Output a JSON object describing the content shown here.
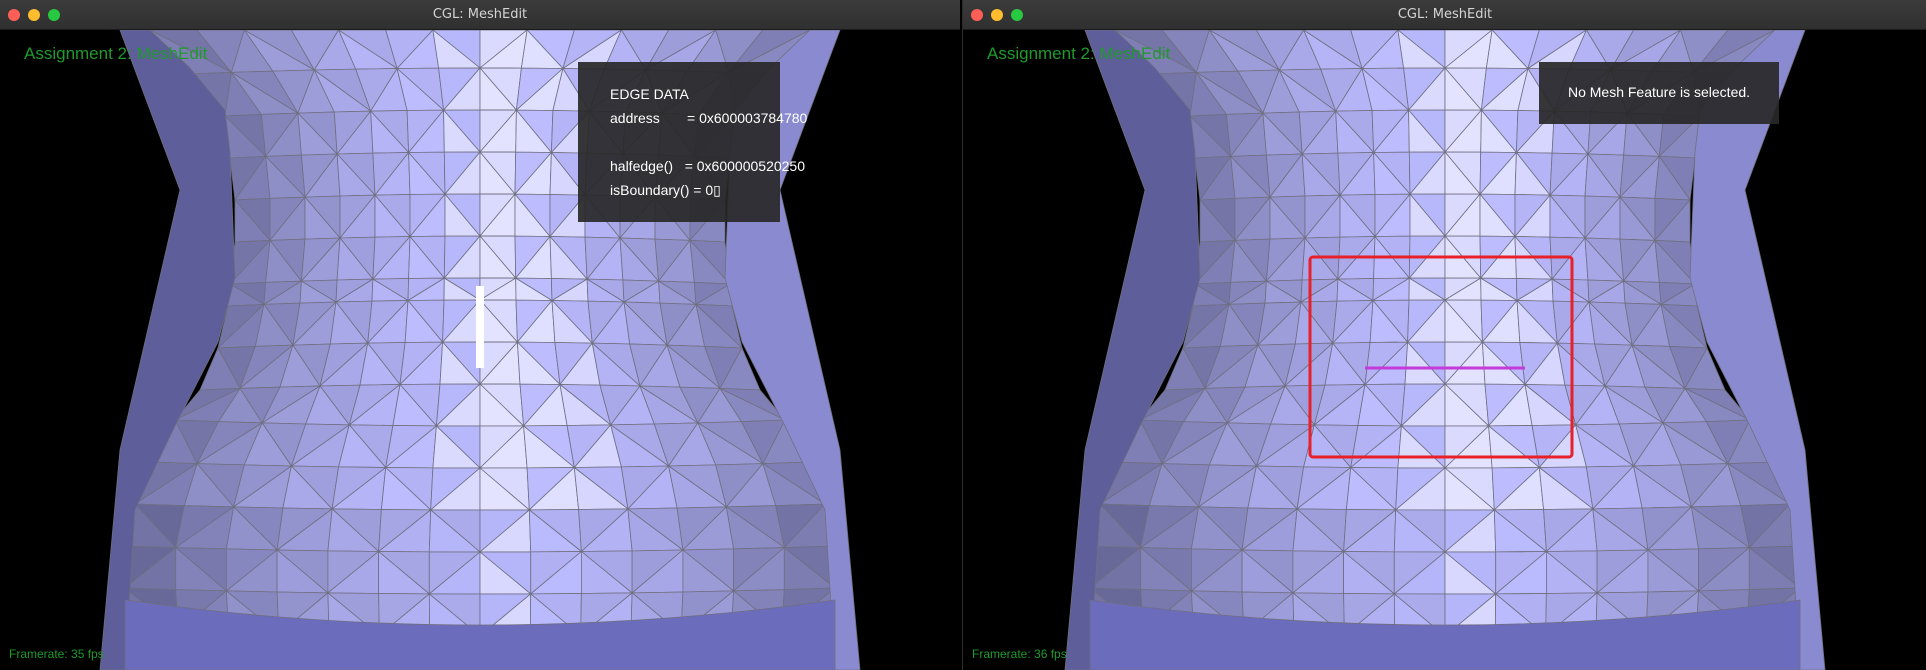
{
  "windows": [
    {
      "title": "CGL: MeshEdit",
      "heading": "Assignment 2: MeshEdit",
      "framerate": "Framerate: 35 fps",
      "panel": {
        "title": "EDGE DATA",
        "address": "address       = 0x600003784780",
        "halfedge": "halfedge()   = 0x600000520250",
        "isBoundary": "isBoundary() = 0▯"
      }
    },
    {
      "title": "CGL: MeshEdit",
      "heading": "Assignment 2: MeshEdit",
      "framerate": "Framerate: 36 fps",
      "panel": {
        "message": "No Mesh Feature is selected."
      }
    }
  ],
  "colors": {
    "mesh_fill": "#c6c6fa",
    "mesh_line": "#6f6f80",
    "heading": "#1f9a2c",
    "highlight_box": "#e8202a",
    "flipped_edge": "#c43bd9",
    "selected_edge": "#ffffff"
  }
}
